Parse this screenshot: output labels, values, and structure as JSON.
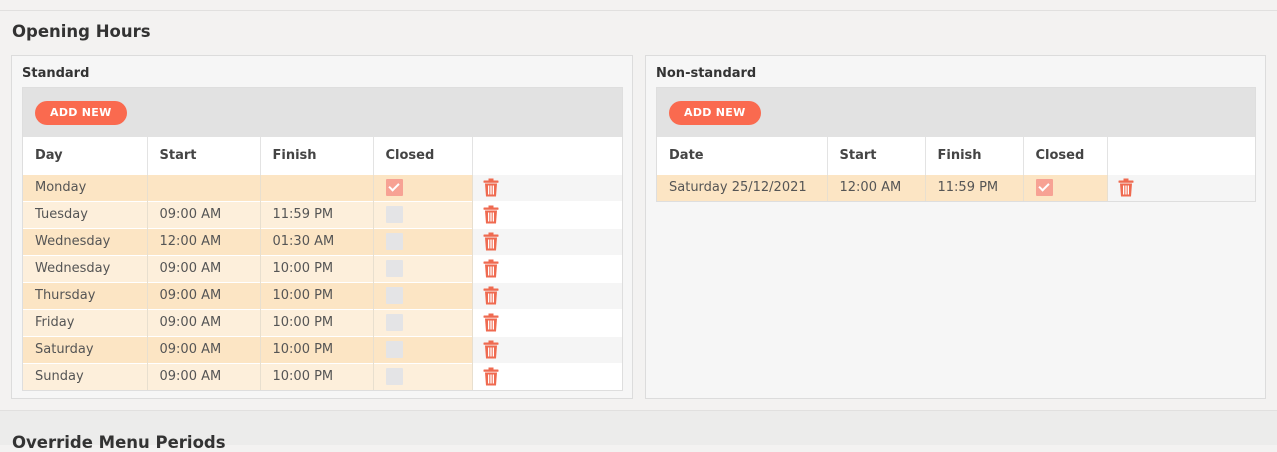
{
  "section": {
    "title": "Opening Hours"
  },
  "next_section": {
    "title": "Override Menu Periods"
  },
  "standard": {
    "title": "Standard",
    "add_label": "ADD NEW",
    "columns": [
      "Day",
      "Start",
      "Finish",
      "Closed"
    ],
    "rows": [
      {
        "day": "Monday",
        "start": "",
        "finish": "",
        "closed": true
      },
      {
        "day": "Tuesday",
        "start": "09:00 AM",
        "finish": "11:59 PM",
        "closed": false
      },
      {
        "day": "Wednesday",
        "start": "12:00 AM",
        "finish": "01:30 AM",
        "closed": false
      },
      {
        "day": "Wednesday",
        "start": "09:00 AM",
        "finish": "10:00 PM",
        "closed": false
      },
      {
        "day": "Thursday",
        "start": "09:00 AM",
        "finish": "10:00 PM",
        "closed": false
      },
      {
        "day": "Friday",
        "start": "09:00 AM",
        "finish": "10:00 PM",
        "closed": false
      },
      {
        "day": "Saturday",
        "start": "09:00 AM",
        "finish": "10:00 PM",
        "closed": false
      },
      {
        "day": "Sunday",
        "start": "09:00 AM",
        "finish": "10:00 PM",
        "closed": false
      }
    ]
  },
  "nonstandard": {
    "title": "Non-standard",
    "add_label": "ADD NEW",
    "columns": [
      "Date",
      "Start",
      "Finish",
      "Closed"
    ],
    "rows": [
      {
        "date": "Saturday 25/12/2021",
        "start": "12:00 AM",
        "finish": "11:59 PM",
        "closed": true
      }
    ]
  },
  "icons": {
    "delete": "trash-icon",
    "check": "check-icon"
  },
  "colors": {
    "accent": "#fa6a4f",
    "row_highlight": "#fce5c4",
    "row_alt": "#fdefdb",
    "trash": "#ef6a50"
  }
}
